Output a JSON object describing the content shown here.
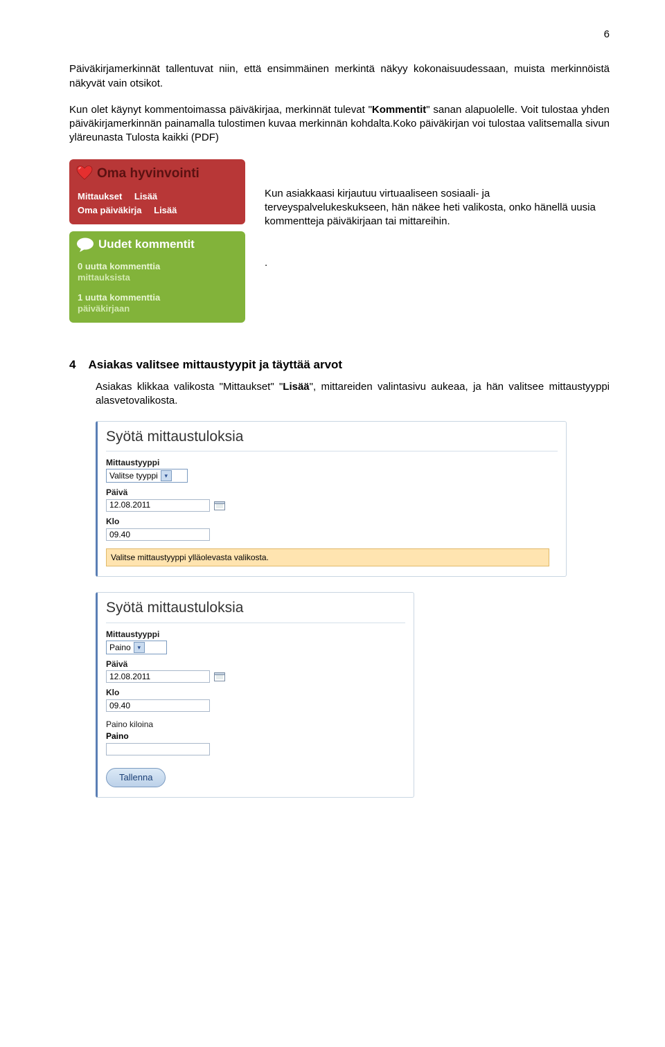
{
  "page": {
    "number": "6"
  },
  "para1": {
    "t1": "Päiväkirjamerkinnät tallentuvat niin, että ensimmäinen merkintä näkyy kokonaisuudessaan, muista merkinnöistä näkyvät vain otsikot."
  },
  "para2": {
    "t1": "Kun olet käynyt kommentoimassa päiväkirjaa, merkinnät tulevat \"",
    "bold1": "Kommentit",
    "t2": "\" sanan alapuolelle. Voit tulostaa yhden päiväkirjamerkinnän painamalla tulostimen kuvaa merkinnän kohdalta.Koko päiväkirjan voi tulostaa valitsemalla sivun yläreunasta Tulosta kaikki (PDF)"
  },
  "widget_red": {
    "title": "Oma hyvinvointi",
    "r1a": "Mittaukset",
    "r1b": "Lisää",
    "r2a": "Oma päiväkirja",
    "r2b": "Lisää"
  },
  "widget_green": {
    "title": "Uudet kommentit",
    "s1_top": "0 uutta kommenttia",
    "s1_sub": "mittauksista",
    "s2_top": "1 uutta kommenttia",
    "s2_sub": "päiväkirjaan"
  },
  "side_text": {
    "body": "Kun asiakkaasi kirjautuu virtuaaliseen sosiaali- ja terveyspalvelukeskukseen, hän näkee heti valikosta, onko hänellä uusia kommentteja päiväkirjaan tai mittareihin.",
    "dot": "."
  },
  "section4": {
    "num": "4",
    "title": "Asiakas valitsee mittaustyypit ja täyttää arvot",
    "body_a": "Asiakas klikkaa valikosta \"Mittaukset\" \"",
    "body_bold": "Lisää",
    "body_b": "\", mittareiden valintasivu aukeaa, ja hän valitsee mittaustyyppi alasvetovalikosta."
  },
  "form1": {
    "title": "Syötä mittaustuloksia",
    "f_type_label": "Mittaustyyppi",
    "f_type_value": "Valitse tyyppi",
    "f_day_label": "Päivä",
    "f_day_value": "12.08.2011",
    "f_time_label": "Klo",
    "f_time_value": "09.40",
    "notice": "Valitse mittaustyyppi ylläolevasta valikosta."
  },
  "form2": {
    "title": "Syötä mittaustuloksia",
    "f_type_label": "Mittaustyyppi",
    "f_type_value": "Paino",
    "f_day_label": "Päivä",
    "f_day_value": "12.08.2011",
    "f_time_label": "Klo",
    "f_time_value": "09.40",
    "f_kg_label": "Paino kiloina",
    "f_weight_label": "Paino",
    "save": "Tallenna"
  }
}
